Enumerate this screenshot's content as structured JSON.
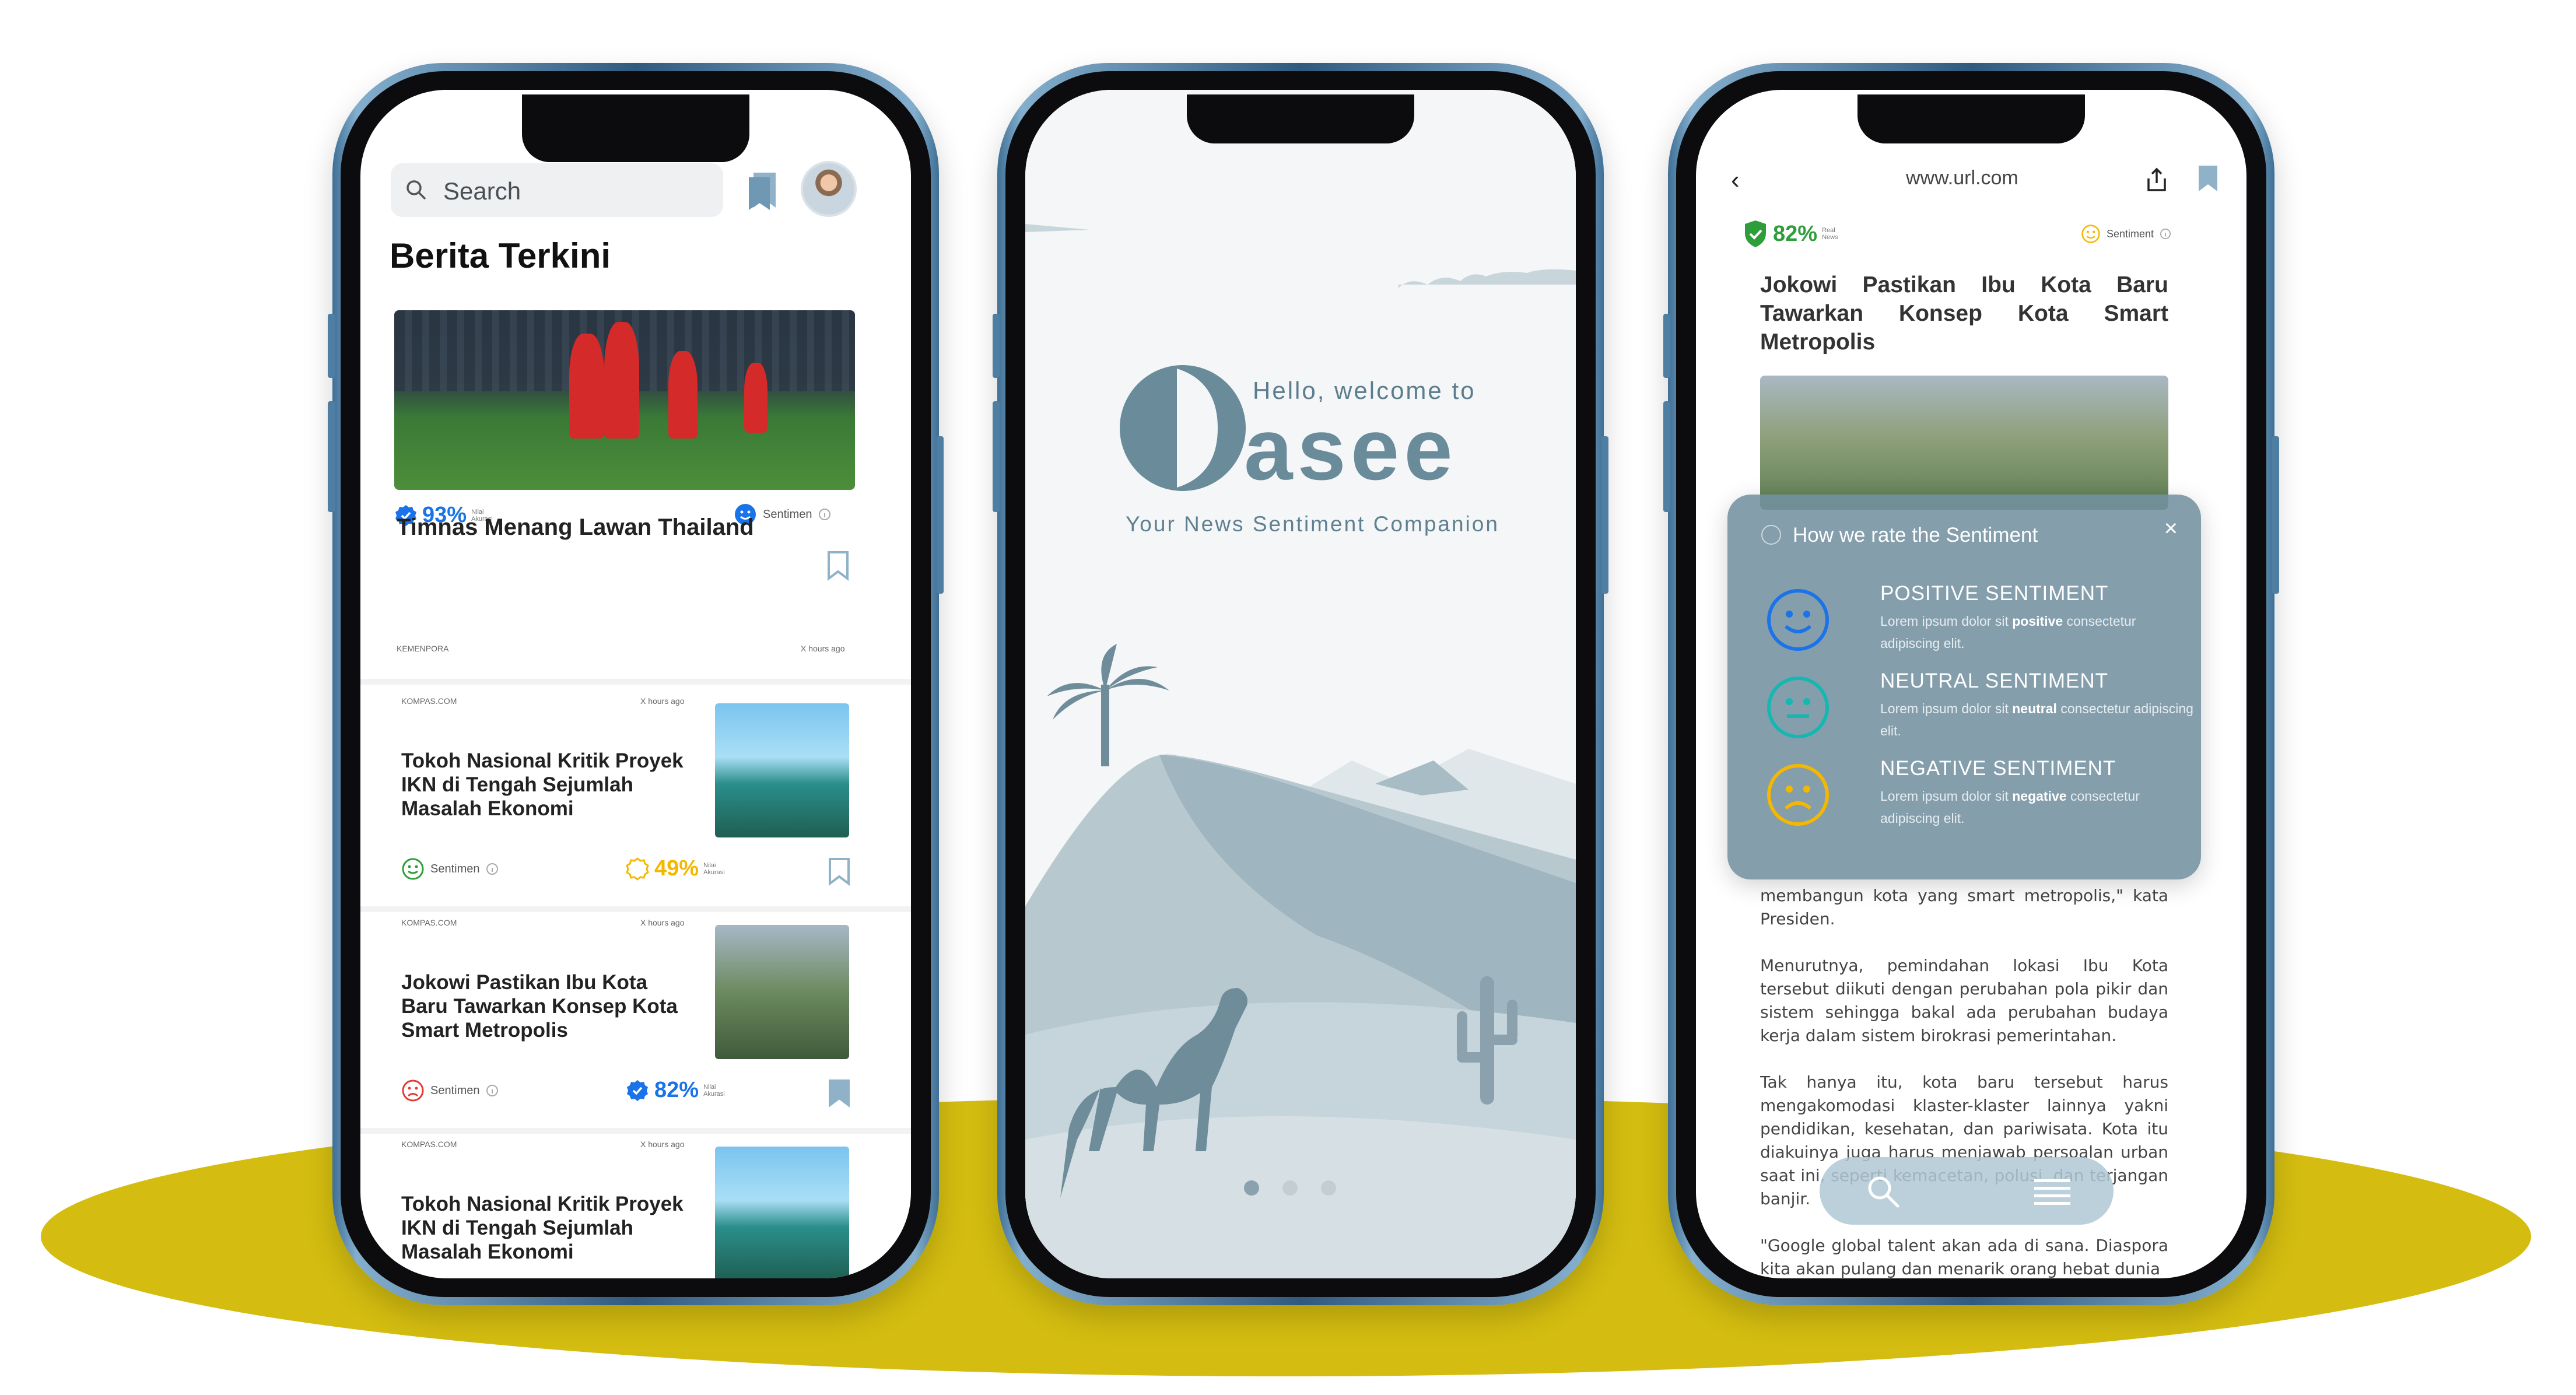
{
  "colors": {
    "accent_yellow": "#d4bd10",
    "phone_frame": "#3a6c93",
    "brand": "#6a8b9a",
    "positive": "#1a73e8",
    "neutral": "#14b8b0",
    "negative": "#f5b800"
  },
  "phone1": {
    "search_placeholder": "Search",
    "title": "Berita Terkini",
    "featured": {
      "accuracy": "93%",
      "accuracy_label_1": "Nilai",
      "accuracy_label_2": "Akurasi",
      "sentiment_label": "Sentimen",
      "headline": "Timnas Menang Lawan Thailand",
      "source": "KEMENPORA",
      "time": "X hours ago"
    },
    "cards": [
      {
        "source": "KOMPAS.COM",
        "time": "X hours ago",
        "headline": "Tokoh Nasional Kritik Proyek IKN di Tengah Sejumlah Masalah Ekonomi",
        "sentiment_label": "Sentimen",
        "accuracy": "49%",
        "accuracy_label_1": "Nilai",
        "accuracy_label_2": "Akurasi"
      },
      {
        "source": "KOMPAS.COM",
        "time": "X hours ago",
        "headline": "Jokowi Pastikan Ibu Kota Baru Tawarkan Konsep Kota Smart Metropolis",
        "sentiment_label": "Sentimen",
        "accuracy": "82%",
        "accuracy_label_1": "Nilai",
        "accuracy_label_2": "Akurasi"
      },
      {
        "source": "KOMPAS.COM",
        "time": "X hours ago",
        "headline": "Tokoh Nasional Kritik Proyek IKN di Tengah Sejumlah Masalah Ekonomi"
      }
    ]
  },
  "phone2": {
    "hello": "Hello, welcome to",
    "wordmark": "asee",
    "tagline": "Your News Sentiment Companion"
  },
  "phone3": {
    "url": "www.url.com",
    "accuracy": "82%",
    "accuracy_label_1": "Real",
    "accuracy_label_2": "News",
    "sentiment_label": "Sentiment",
    "headline_line1": "Jokowi Pastikan Ibu Kota Baru",
    "headline_line2": "Tawarkan Konsep Kota Smart",
    "headline_line3": "Metropolis",
    "popup": {
      "title": "How we rate the Sentiment",
      "close": "×",
      "items": [
        {
          "name": "POSITIVE SENTIMENT",
          "pre": "Lorem ipsum dolor sit ",
          "bold": "positive",
          "post": " consectetur adipiscing elit."
        },
        {
          "name": "NEUTRAL SENTIMENT",
          "pre": "Lorem ipsum dolor sit ",
          "bold": "neutral",
          "post": " consectetur adipiscing elit."
        },
        {
          "name": "NEGATIVE SENTIMENT",
          "pre": "Lorem ipsum dolor sit ",
          "bold": "negative",
          "post": " consectetur adipiscing elit."
        }
      ]
    },
    "body": [
      "membangun kota yang smart metropolis,\" kata Presiden.",
      "Menurutnya, pemindahan lokasi Ibu Kota tersebut diikuti dengan perubahan pola pikir dan sistem sehingga bakal ada perubahan budaya kerja dalam sistem birokrasi pemerintahan.",
      "Tak hanya itu, kota baru tersebut harus mengakomodasi klaster-klaster lainnya yakni pendidikan, kesehatan, dan pariwisata. Kota itu diakuinya juga harus menjawab persoalan urban saat ini, seperti kemacetan, polusi, dan terjangan banjir.",
      "\"Google global talent akan ada di sana. Diaspora kita akan pulang dan menarik orang hebat dunia"
    ]
  }
}
